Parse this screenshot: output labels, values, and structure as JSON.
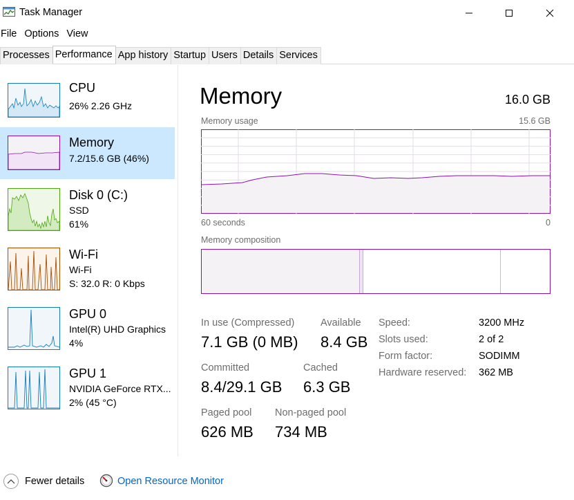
{
  "window": {
    "title": "Task Manager",
    "icon": "task-manager-icon"
  },
  "menu": [
    "File",
    "Options",
    "View"
  ],
  "tabs": [
    {
      "label": "Processes",
      "active": false
    },
    {
      "label": "Performance",
      "active": true
    },
    {
      "label": "App history",
      "active": false
    },
    {
      "label": "Startup",
      "active": false
    },
    {
      "label": "Users",
      "active": false
    },
    {
      "label": "Details",
      "active": false
    },
    {
      "label": "Services",
      "active": false
    }
  ],
  "sidebar": [
    {
      "name": "CPU",
      "lines": [
        "26%  2.26 GHz"
      ],
      "color": "#117dbb",
      "fill": "#f1f6fa",
      "selected": false
    },
    {
      "name": "Memory",
      "lines": [
        "7.2/15.6 GB (46%)"
      ],
      "color": "#8b12ae",
      "fill": "#f4f2f4",
      "selected": true
    },
    {
      "name": "Disk 0 (C:)",
      "lines": [
        "SSD",
        "61%"
      ],
      "color": "#4da60c",
      "fill": "#eff7e8",
      "selected": false
    },
    {
      "name": "Wi-Fi",
      "lines": [
        "Wi-Fi",
        "S: 32.0  R: 0 Kbps"
      ],
      "color": "#a74f01",
      "fill": "#fcf3eb",
      "selected": false
    },
    {
      "name": "GPU 0",
      "lines": [
        "Intel(R) UHD Graphics",
        "4%"
      ],
      "color": "#117dbb",
      "fill": "#f1f6fa",
      "selected": false
    },
    {
      "name": "GPU 1",
      "lines": [
        "NVIDIA GeForce RTX...",
        "2% (45 °C)"
      ],
      "color": "#117dbb",
      "fill": "#f1f6fa",
      "selected": false
    }
  ],
  "memory": {
    "title": "Memory",
    "total": "16.0 GB",
    "usage_label": "Memory usage",
    "usage_max": "15.6 GB",
    "time_left": "60 seconds",
    "time_right": "0",
    "composition_label": "Memory composition",
    "stats": [
      {
        "label": "In use (Compressed)",
        "value": "7.1 GB (0 MB)"
      },
      {
        "label": "Available",
        "value": "8.4 GB"
      },
      {
        "label": "Committed",
        "value": "8.4/29.1 GB"
      },
      {
        "label": "Cached",
        "value": "6.3 GB"
      },
      {
        "label": "Paged pool",
        "value": "626 MB"
      },
      {
        "label": "Non-paged pool",
        "value": "734 MB"
      }
    ],
    "details": [
      {
        "key": "Speed:",
        "value": "3200 MHz"
      },
      {
        "key": "Slots used:",
        "value": "2 of 2"
      },
      {
        "key": "Form factor:",
        "value": "SODIMM"
      },
      {
        "key": "Hardware reserved:",
        "value": "362 MB"
      }
    ],
    "accent": "#8b12ae",
    "graph_fill": "#f4f2f4",
    "grid": "#e4dbe7"
  },
  "footer": {
    "fewer_details": "Fewer details",
    "open_resource_monitor": "Open Resource Monitor"
  }
}
